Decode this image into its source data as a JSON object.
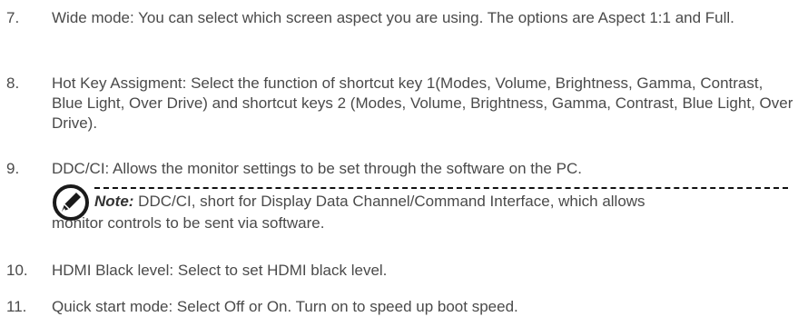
{
  "items": [
    {
      "number": "7.",
      "text": "Wide mode: You can select which screen aspect you are using. The options are Aspect 1:1 and Full."
    },
    {
      "number": "8.",
      "text": "Hot Key Assigment: Select the function of shortcut key 1(Modes, Volume, Brightness, Gamma, Contrast, Blue Light, Over Drive) and shortcut keys 2 (Modes, Volume, Brightness, Gamma, Contrast, Blue Light, Over Drive)."
    },
    {
      "number": "9.",
      "text": "DDC/CI: Allows the monitor settings to be set through the software on the PC."
    },
    {
      "number": "10.",
      "text": "HDMI Black level: Select to set HDMI black level."
    },
    {
      "number": "11.",
      "text": "Quick start mode: Select Off or On. Turn on to speed up boot speed."
    }
  ],
  "note": {
    "label": "Note:",
    "line1": " DDC/CI, short for Display Data Channel/Command Interface, which allows",
    "line2": "monitor controls to be sent via software.",
    "icon": "note-pen-icon"
  }
}
